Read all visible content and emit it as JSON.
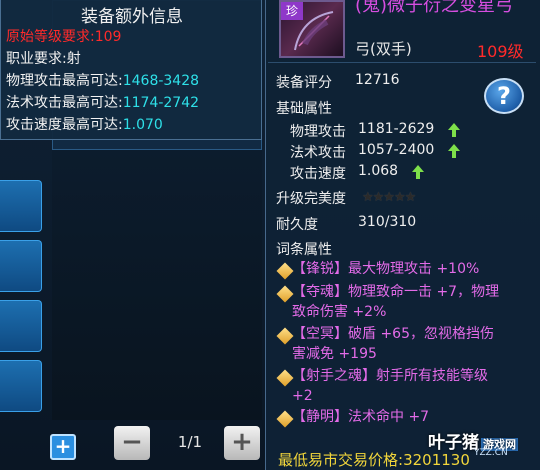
{
  "extra_info": {
    "title": "装备额外信息",
    "lines": [
      {
        "label": "原始等级要求:",
        "value": "109",
        "color": "#ff2a2a"
      },
      {
        "label": "职业要求:",
        "value": "射"
      },
      {
        "label": "物理攻击最高可达:",
        "value": "1468-3428"
      },
      {
        "label": "法术攻击最高可达:",
        "value": "1174-2742"
      },
      {
        "label": "攻击速度最高可达:",
        "value": "1.070"
      }
    ]
  },
  "item": {
    "badge": "珍",
    "name": "(鬼)微子衍之变星弓",
    "type": "弓(双手)",
    "level": "109级"
  },
  "detail": {
    "score_label": "装备评分",
    "score_value": "12716",
    "base_label": "基础属性",
    "stats": [
      {
        "label": "物理攻击",
        "value": "1181-2629"
      },
      {
        "label": "法术攻击",
        "value": "1057-2400"
      },
      {
        "label": "攻击速度",
        "value": "1.068"
      }
    ],
    "upgrade_label": "升级完美度",
    "stars": "★★★★★",
    "durability_label": "耐久度",
    "durability_value": "310/310",
    "affix_label": "词条属性",
    "affixes": [
      {
        "text": "【锋锐】最大物理攻击 +10%"
      },
      {
        "text": "【夺魂】物理致命一击 +7，物理",
        "text2": "致命伤害 +2%"
      },
      {
        "text": "【空冥】破盾 +65，忽视格挡伤",
        "text2": "害减免 +195"
      },
      {
        "text": "【射手之魂】射手所有技能等级",
        "text2": "+2"
      },
      {
        "text": "【静明】法术命中 +7"
      }
    ],
    "price_label": "最低易市交易价格:",
    "price_value": "3201130"
  },
  "pager": {
    "page": "1/1"
  },
  "watermark": {
    "main": "叶子猪",
    "sub": "游戏网",
    "url": "YZZ.CN"
  },
  "colors": {
    "cyan": "#2ee0e8",
    "red": "#ff2a2a",
    "purple": "#d64ee0",
    "gold": "#f2d63b",
    "up_arrow": "#7ee04a"
  },
  "help_icon": "question-icon"
}
